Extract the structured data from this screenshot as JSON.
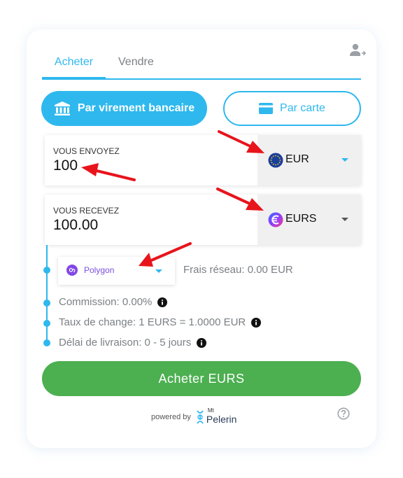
{
  "tabs": {
    "buy": "Acheter",
    "sell": "Vendre"
  },
  "payment": {
    "bank_label": "Par virement bancaire",
    "card_label": "Par carte"
  },
  "send": {
    "label": "VOUS ENVOYEZ",
    "value": "100",
    "currency": "EUR"
  },
  "receive": {
    "label": "VOUS RECEVEZ",
    "value": "100.00",
    "currency": "EURS"
  },
  "network": {
    "label": "Polygon",
    "fee": "Frais réseau: 0.00 EUR"
  },
  "details": {
    "commission": "Commission: 0.00%",
    "rate": "Taux de change: 1 EURS = 1.0000 EUR",
    "delivery": "Délai de livraison: 0 - 5 jours"
  },
  "submit_label": "Acheter EURS",
  "footer": {
    "powered_by": "powered by",
    "logo_mt": "Mt",
    "logo_name": "Pelerin"
  },
  "colors": {
    "accent": "#2eb8ee",
    "submit": "#4caf50",
    "annotation_arrow": "#e8141c",
    "polygon": "#8247e5"
  },
  "icons": {
    "user": "user-settings-icon",
    "bank": "bank-icon",
    "card": "credit-card-icon",
    "eur_coin": "eur-coin-icon",
    "eurs_coin": "eurs-coin-icon",
    "polygon": "polygon-icon",
    "info": "info-icon",
    "help": "help-circle-icon"
  }
}
